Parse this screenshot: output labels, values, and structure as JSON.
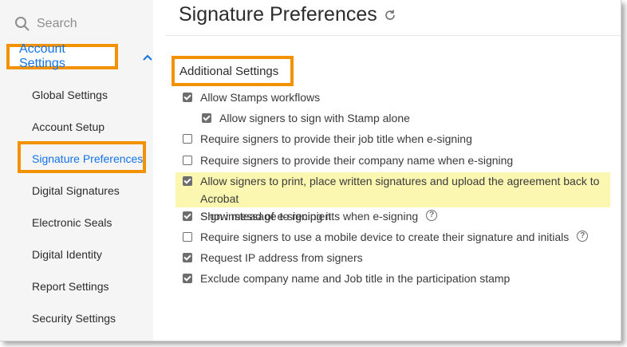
{
  "sidebar": {
    "search": {
      "placeholder": "Search",
      "icon": "search-icon"
    },
    "section": {
      "label": "Account Settings",
      "expanded": true,
      "icon": "chevron-up-icon"
    },
    "items": [
      {
        "label": "Global Settings",
        "active": false
      },
      {
        "label": "Account Setup",
        "active": false
      },
      {
        "label": "Signature Preferences",
        "active": true
      },
      {
        "label": "Digital Signatures",
        "active": false
      },
      {
        "label": "Electronic Seals",
        "active": false
      },
      {
        "label": "Digital Identity",
        "active": false
      },
      {
        "label": "Report Settings",
        "active": false
      },
      {
        "label": "Security Settings",
        "active": false
      }
    ]
  },
  "main": {
    "title": "Signature Preferences",
    "refresh_icon": "refresh-icon",
    "section_title": "Additional Settings",
    "options": [
      {
        "line1": "Allow Stamps workflows",
        "checked": true
      },
      {
        "line1": "Allow signers to sign with Stamp alone",
        "checked": true
      },
      {
        "line1": "Require signers to provide their job title when e-signing",
        "checked": false
      },
      {
        "line1": "Require signers to provide their company name when e-signing",
        "checked": false
      },
      {
        "line1": "Allow signers to print, place written signatures and upload the agreement back to Acrobat",
        "line2": "Sign instead of e-signing it",
        "checked": true,
        "highlighted": true
      },
      {
        "line1": "Show message to recipients when e-signing",
        "checked": true,
        "help": "?"
      },
      {
        "line1": "Require signers to use a mobile device to create their signature and initials",
        "checked": false,
        "help": "?"
      },
      {
        "line1": "Request IP address from signers",
        "checked": true
      },
      {
        "line1": "Exclude company name and Job title in the participation stamp",
        "checked": true
      }
    ]
  },
  "colors": {
    "accent": "#1473e6",
    "callout": "#f39200",
    "highlight": "#fbf7b1"
  }
}
